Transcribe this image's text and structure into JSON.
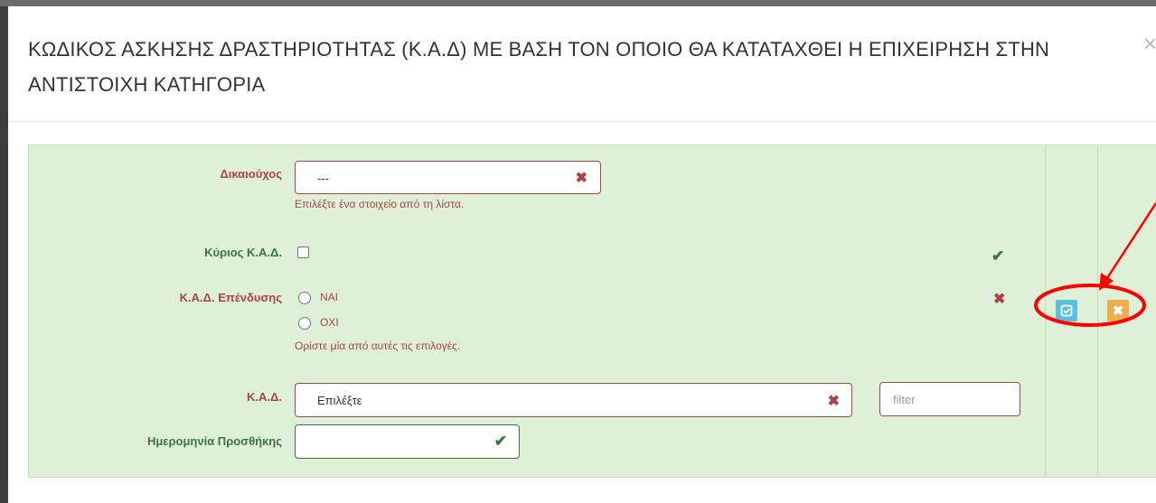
{
  "modal": {
    "title": "ΚΩΔΙΚΟΣ ΑΣΚΗΣΗΣ ΔΡΑΣΤΗΡΙΟΤΗΤΑΣ (Κ.Α.Δ) ΜΕ ΒΑΣΗ ΤΟΝ ΟΠΟΙΟ ΘΑ ΚΑΤΑΤΑΧΘΕΙ Η ΕΠΙΧΕΙΡΗΣΗ ΣΤΗΝ ΑΝΤΙΣΤΟΙΧΗ ΚΑΤΗΓΟΡΙΑ",
    "close_glyph": "×"
  },
  "form": {
    "beneficiary": {
      "label": "Δικαιούχος",
      "value": "---",
      "error": "Επιλέξτε ένα στοιχείο από τη λίστα."
    },
    "main_kad": {
      "label": "Κύριος Κ.Α.Δ.",
      "checked": false
    },
    "investment_kad": {
      "label": "Κ.Α.Δ. Επένδυσης",
      "options": [
        "ΝΑΙ",
        "ΟΧΙ"
      ],
      "error": "Ορίστε μία από αυτές τις επιλογές."
    },
    "kad": {
      "label": "Κ.Α.Δ.",
      "value": "Επιλέξτε",
      "filter_placeholder": "filter"
    },
    "date_added": {
      "label": "Ημερομηνία Προσθήκης",
      "value": ""
    }
  },
  "actions": {
    "edit_icon": "check-square-icon",
    "cancel_icon": "times-icon"
  },
  "colors": {
    "panel_bg": "#dff0d8",
    "error": "#a94442",
    "success": "#3c763d",
    "edit_btn": "#5bc0de",
    "cancel_btn": "#f0ad4e",
    "annotation": "#ff0000"
  }
}
